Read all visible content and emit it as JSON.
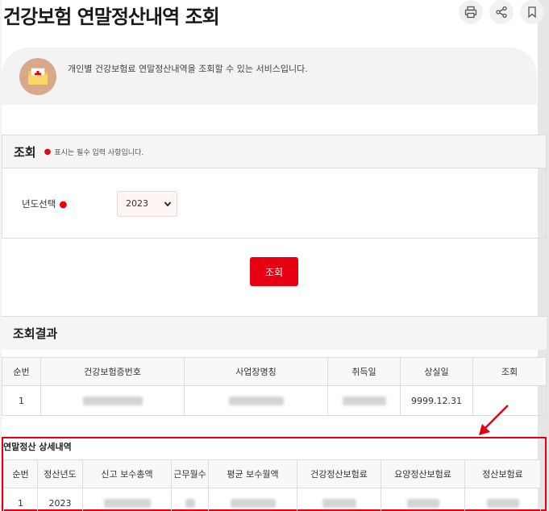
{
  "page": {
    "title": "건강보험 연말정산내역 조회",
    "description": "개인별 건강보험료 연말정산내역을 조회할 수 있는 서비스입니다."
  },
  "actions": {
    "print_icon": "printer-icon",
    "share_icon": "share-icon",
    "bookmark_icon": "bookmark-icon"
  },
  "query": {
    "title": "조회",
    "required_note": "표시는 필수 입력 사항입니다.",
    "year_label": "년도선택",
    "year_value": "2023",
    "search_label": "조회"
  },
  "result": {
    "title": "조회결과",
    "columns": [
      "순번",
      "건강보험증번호",
      "사업장명칭",
      "취득일",
      "상실일",
      "조회"
    ],
    "rows": [
      {
        "no": "1",
        "loss_date": "9999.12.31"
      }
    ]
  },
  "detail": {
    "title": "연말정산 상세내역",
    "columns": [
      "순번",
      "정산년도",
      "신고 보수총액",
      "근무월수",
      "평균 보수월액",
      "건강정산보험료",
      "요양정산보험료",
      "정산보험료"
    ],
    "rows": [
      {
        "no": "1",
        "year": "2023"
      }
    ]
  },
  "colors": {
    "accent": "#e60012",
    "header_bg": "#f5f5f5",
    "border": "#dddddd"
  }
}
